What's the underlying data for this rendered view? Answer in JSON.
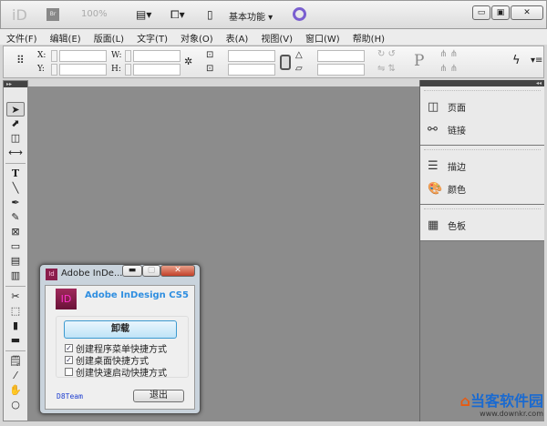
{
  "titlebar": {
    "app_logo": "iD",
    "bridge": "Br",
    "zoom": "100%",
    "workspace": "基本功能"
  },
  "menu": [
    "文件(F)",
    "编辑(E)",
    "版面(L)",
    "文字(T)",
    "对象(O)",
    "表(A)",
    "视图(V)",
    "窗口(W)",
    "帮助(H)"
  ],
  "control": {
    "x": "X:",
    "y": "Y:",
    "w": "W:",
    "h": "H:"
  },
  "tools": [
    "selection",
    "direct-selection",
    "page",
    "gap",
    "type",
    "line",
    "pen",
    "pencil",
    "rectangle-frame",
    "rectangle",
    "horizontal-grid",
    "vertical-grid",
    "scissors",
    "free-transform",
    "gradient-swatch",
    "gradient-feather",
    "note",
    "eyedropper",
    "hand",
    "zoom"
  ],
  "panels": [
    {
      "items": [
        {
          "icon": "pages-icon",
          "label": "页面"
        },
        {
          "icon": "links-icon",
          "label": "链接"
        }
      ]
    },
    {
      "items": [
        {
          "icon": "stroke-icon",
          "label": "描边"
        },
        {
          "icon": "color-icon",
          "label": "颜色"
        }
      ]
    },
    {
      "items": [
        {
          "icon": "swatches-icon",
          "label": "色板"
        }
      ]
    }
  ],
  "dialog": {
    "title": "Adobe InDe...",
    "product": "Adobe InDesign CS5",
    "logo": "ID",
    "uninstall": "卸载",
    "options": [
      {
        "label": "创建程序菜单快捷方式",
        "checked": true
      },
      {
        "label": "创建桌面快捷方式",
        "checked": true
      },
      {
        "label": "创建快速启动快捷方式",
        "checked": false
      }
    ],
    "team": "D8Team",
    "exit": "退出"
  },
  "watermark": {
    "name": "当客软件园",
    "url": "www.downkr.com"
  }
}
